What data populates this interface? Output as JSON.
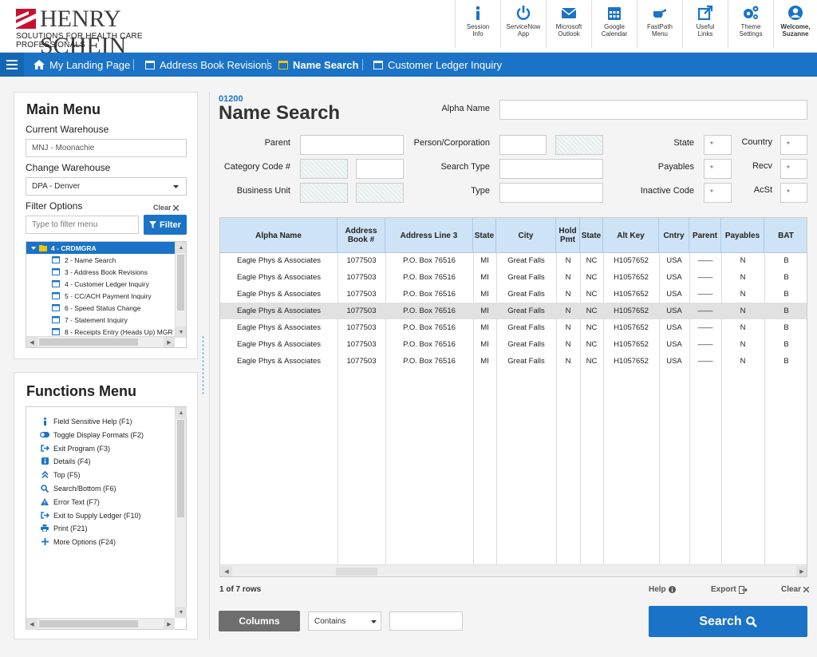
{
  "brand": {
    "name": "HENRY SCHEIN",
    "tagline": "SOLUTIONS FOR HEALTH CARE PROFESSIONALS"
  },
  "tools": [
    {
      "icon": "info-icon",
      "label1": "Session",
      "label2": "Info"
    },
    {
      "icon": "power-icon",
      "label1": "ServiceNow",
      "label2": "App"
    },
    {
      "icon": "mail-icon",
      "label1": "Microsoft",
      "label2": "Outlook"
    },
    {
      "icon": "calendar-icon",
      "label1": "Google",
      "label2": "Calendar"
    },
    {
      "icon": "hand-point-icon",
      "label1": "FastPath",
      "label2": "Menu"
    },
    {
      "icon": "external-link-icon",
      "label1": "Useful",
      "label2": "Links"
    },
    {
      "icon": "cogs-icon",
      "label1": "Theme",
      "label2": "Settings"
    },
    {
      "icon": "user-icon",
      "label1": "Welcome,",
      "label2": "Suzanne"
    }
  ],
  "nav": {
    "tabs": [
      "My Landing Page",
      "Address Book Revisions",
      "Name Search",
      "Customer Ledger Inquiry"
    ]
  },
  "main_menu": {
    "title": "Main Menu",
    "current_warehouse_label": "Current Warehouse",
    "current_warehouse": "MNJ - Moonachie",
    "change_warehouse_label": "Change Warehouse",
    "change_warehouse": "DPA - Denver",
    "filter_label": "Filter Options",
    "clear": "Clear",
    "filter_placeholder": "Type to filter menu",
    "filter_button": "Filter",
    "tree": [
      "4 - CRDMGRA",
      "2 - Name Search",
      "3 - Address Book Revisions",
      "4 - Customer Ledger Inquiry",
      "5 - CC/ACH Payment Inquiry",
      "6 - Speed Status Change",
      "7 - Statement Inquiry",
      "8 - Receipts Entry (Heads Up) MGR"
    ]
  },
  "functions_menu": {
    "title": "Functions Menu",
    "items": [
      {
        "icon": "info-icon",
        "label": "Field Sensitive Help (F1)"
      },
      {
        "icon": "toggle-icon",
        "label": "Toggle Display Formats (F2)"
      },
      {
        "icon": "exit-icon",
        "label": "Exit Program (F3)"
      },
      {
        "icon": "details-icon",
        "label": "Details (F4)"
      },
      {
        "icon": "top-icon",
        "label": "Top (F5)"
      },
      {
        "icon": "search-icon",
        "label": "Search/Bottom (F6)"
      },
      {
        "icon": "warning-icon",
        "label": "Error Text (F7)"
      },
      {
        "icon": "exit-icon",
        "label": "Exit to Supply Ledger (F10)"
      },
      {
        "icon": "print-icon",
        "label": "Print (F21)"
      },
      {
        "icon": "plus-icon",
        "label": "More Options (F24)"
      }
    ]
  },
  "form": {
    "program_number": "01200",
    "title": "Name Search",
    "alpha_name_label": "Alpha Name",
    "parent_label": "Parent",
    "person_corp_label": "Person/Corporation",
    "state_label": "State",
    "state_value": "*",
    "country_label": "Country",
    "country_value": "*",
    "category_code_label": "Category Code #",
    "search_type_label": "Search Type",
    "payables_label": "Payables",
    "payables_value": "*",
    "recv_label": "Recv",
    "recv_value": "*",
    "business_unit_label": "Business Unit",
    "type_label": "Type",
    "inactive_code_label": "Inactive Code",
    "inactive_value": "*",
    "acst_label": "AcSt",
    "acst_value": "*"
  },
  "grid": {
    "columns": [
      "Alpha Name",
      "Address Book #",
      "Address Line 3",
      "State",
      "City",
      "Hold Pmt",
      "State",
      "Alt Key",
      "Cntry",
      "Parent",
      "Payables",
      "BAT"
    ],
    "rows": [
      [
        "Eagle Phys & Associates",
        "1077503",
        "P.O. Box 76516",
        "MI",
        "Great Falls",
        "N",
        "NC",
        "H1057652",
        "USA",
        "——",
        "N",
        "B"
      ],
      [
        "Eagle Phys & Associates",
        "1077503",
        "P.O. Box 76516",
        "MI",
        "Great Falls",
        "N",
        "NC",
        "H1057652",
        "USA",
        "——",
        "N",
        "B"
      ],
      [
        "Eagle Phys & Associates",
        "1077503",
        "P.O. Box 76516",
        "MI",
        "Great Falls",
        "N",
        "NC",
        "H1057652",
        "USA",
        "——",
        "N",
        "B"
      ],
      [
        "Eagle Phys & Associates",
        "1077503",
        "P.O. Box 76516",
        "MI",
        "Great Falls",
        "N",
        "NC",
        "H1057652",
        "USA",
        "——",
        "N",
        "B"
      ],
      [
        "Eagle Phys & Associates",
        "1077503",
        "P.O. Box 76516",
        "MI",
        "Great Falls",
        "N",
        "NC",
        "H1057652",
        "USA",
        "——",
        "N",
        "B"
      ],
      [
        "Eagle Phys & Associates",
        "1077503",
        "P.O. Box 76516",
        "MI",
        "Great Falls",
        "N",
        "NC",
        "H1057652",
        "USA",
        "——",
        "N",
        "B"
      ],
      [
        "Eagle Phys & Associates",
        "1077503",
        "P.O. Box 76516",
        "MI",
        "Great Falls",
        "N",
        "NC",
        "H1057652",
        "USA",
        "——",
        "N",
        "B"
      ]
    ],
    "row_count": "1 of 7 rows",
    "help": "Help",
    "export": "Export",
    "clear": "Clear"
  },
  "bottom": {
    "columns_button": "Columns",
    "contains": "Contains",
    "search_button": "Search"
  },
  "colors": {
    "accent": "#1a73c7",
    "header_blue": "#cfe3f6",
    "brand_red": "#c8102e"
  }
}
